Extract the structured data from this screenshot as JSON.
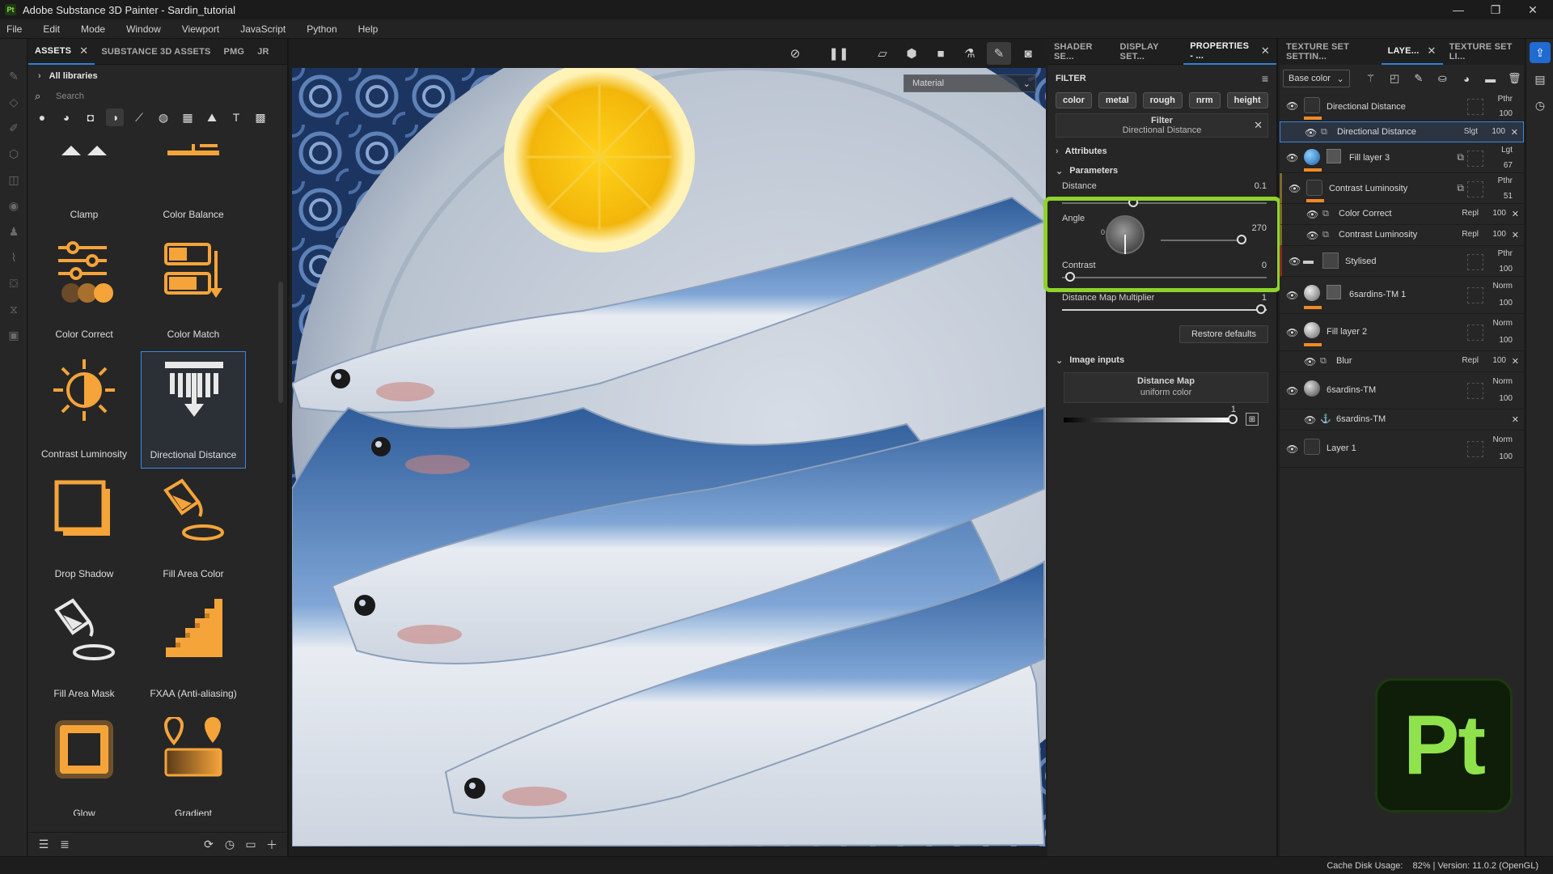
{
  "window": {
    "title": "Adobe Substance 3D Painter - Sardin_tutorial",
    "app_logo": "Pt",
    "controls": [
      "—",
      "❐",
      "✕"
    ]
  },
  "menu": [
    "File",
    "Edit",
    "Mode",
    "Window",
    "Viewport",
    "JavaScript",
    "Python",
    "Help"
  ],
  "assets_panel": {
    "tabs": [
      "ASSETS",
      "SUBSTANCE 3D ASSETS",
      "PMG",
      "JR"
    ],
    "close_glyph": "✕",
    "all_libraries": "All libraries",
    "search_placeholder": "Search",
    "items": [
      {
        "label": "Clamp",
        "icon": "clamp-icon"
      },
      {
        "label": "Color Balance",
        "icon": "color-balance-icon"
      },
      {
        "label": "Color Correct",
        "icon": "color-correct-icon"
      },
      {
        "label": "Color Match",
        "icon": "color-match-icon"
      },
      {
        "label": "Contrast Luminosity",
        "icon": "contrast-luminosity-icon"
      },
      {
        "label": "Directional Distance",
        "icon": "directional-distance-icon",
        "selected": true
      },
      {
        "label": "Drop Shadow",
        "icon": "drop-shadow-icon"
      },
      {
        "label": "Fill Area Color",
        "icon": "fill-area-color-icon"
      },
      {
        "label": "Fill Area Mask",
        "icon": "fill-area-mask-icon"
      },
      {
        "label": "FXAA (Anti-aliasing)",
        "icon": "fxaa-icon"
      },
      {
        "label": "Glow",
        "icon": "glow-icon"
      },
      {
        "label": "Gradient",
        "icon": "gradient-icon"
      }
    ]
  },
  "viewport": {
    "material_dropdown": "Material"
  },
  "properties_panel": {
    "tabs": [
      "SHADER SE...",
      "DISPLAY SET...",
      "PROPERTIES - ..."
    ],
    "filter_heading": "FILTER",
    "channel_chips": [
      "color",
      "metal",
      "rough",
      "nrm",
      "height"
    ],
    "filter_box_title": "Filter",
    "filter_box_name": "Directional Distance",
    "attributes_label": "Attributes",
    "parameters_label": "Parameters",
    "distance": {
      "label": "Distance",
      "value": "0.1"
    },
    "angle": {
      "label": "Angle",
      "value": "270",
      "dial_zero": "0"
    },
    "contrast": {
      "label": "Contrast",
      "value": "0"
    },
    "distance_map_multiplier": {
      "label": "Distance Map Multiplier",
      "value": "1"
    },
    "restore_defaults": "Restore defaults",
    "image_inputs_label": "Image inputs",
    "distance_map": {
      "title": "Distance Map",
      "subtitle": "uniform color",
      "value": "1"
    }
  },
  "layers_panel": {
    "tabs": [
      "TEXTURE SET SETTIN...",
      "LAYE...",
      "TEXTURE SET LI..."
    ],
    "channel_dropdown": "Base color",
    "rows": [
      {
        "name": "Directional Distance",
        "blend": "Pthr",
        "opacity": "100",
        "type": "paint"
      },
      {
        "name": "Directional Distance",
        "blend": "Slgt",
        "opacity": "100",
        "type": "filter",
        "sub": true,
        "selected": true
      },
      {
        "name": "Fill layer 3",
        "blend": "Lgt",
        "opacity": "67",
        "type": "fill"
      },
      {
        "name": "Contrast Luminosity",
        "blend": "Pthr",
        "opacity": "51",
        "type": "paint"
      },
      {
        "name": "Color Correct",
        "blend": "Repl",
        "opacity": "100",
        "type": "filter",
        "sub": true
      },
      {
        "name": "Contrast Luminosity",
        "blend": "Repl",
        "opacity": "100",
        "type": "filter",
        "sub": true
      },
      {
        "name": "Stylised",
        "blend": "Pthr",
        "opacity": "100",
        "type": "folder"
      },
      {
        "name": "6sardins-TM 1",
        "blend": "Norm",
        "opacity": "100",
        "type": "fill"
      },
      {
        "name": "Fill layer 2",
        "blend": "Norm",
        "opacity": "100",
        "type": "fill"
      },
      {
        "name": "Blur",
        "blend": "Repl",
        "opacity": "100",
        "type": "filter",
        "sub": true
      },
      {
        "name": "6sardins-TM",
        "blend": "Norm",
        "opacity": "100",
        "type": "fill"
      },
      {
        "name": "6sardins-TM",
        "blend": "",
        "opacity": "",
        "type": "anchor",
        "sub": true
      },
      {
        "name": "Layer 1",
        "blend": "Norm",
        "opacity": "100",
        "type": "paint"
      }
    ]
  },
  "status": {
    "cache": "Cache Disk Usage:",
    "info": "82% | Version: 11.0.2 (OpenGL)"
  },
  "badge": "Pt",
  "colors": {
    "accent_orange": "#f5a43a",
    "highlight_green": "#8fd32a",
    "selection_blue": "#2d7fd6"
  }
}
